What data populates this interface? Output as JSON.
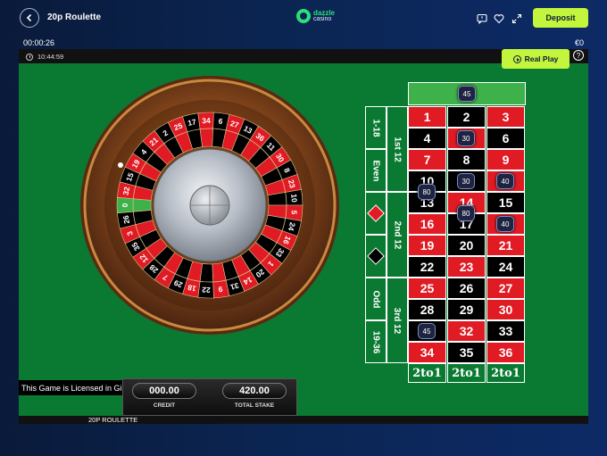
{
  "header": {
    "title": "20p Roulette",
    "logo_line1": "dazzle",
    "logo_line2": "casino",
    "deposit_label": "Deposit"
  },
  "session": {
    "timer": "00:00:26",
    "balance": "€0"
  },
  "game": {
    "clock": "10:44:59",
    "real_play_label": "Real Play",
    "help_label": "?",
    "license_text": "This Game is Licensed in Gibraltar",
    "credit_value": "000.00",
    "credit_label": "CREDIT",
    "stake_value": "420.00",
    "stake_label": "TOTAL STAKE",
    "game_name": "20P ROULETTE"
  },
  "wheel": {
    "numbers": [
      "0",
      "32",
      "15",
      "19",
      "4",
      "21",
      "2",
      "25",
      "17",
      "34",
      "6",
      "27",
      "13",
      "36",
      "11",
      "30",
      "8",
      "23",
      "10",
      "5",
      "24",
      "16",
      "33",
      "1",
      "20",
      "14",
      "31",
      "9",
      "22",
      "18",
      "29",
      "7",
      "28",
      "12",
      "35",
      "3",
      "26"
    ]
  },
  "table": {
    "rows": [
      [
        {
          "n": "1",
          "c": "red"
        },
        {
          "n": "2",
          "c": "black"
        },
        {
          "n": "3",
          "c": "red"
        }
      ],
      [
        {
          "n": "4",
          "c": "black"
        },
        {
          "n": "5",
          "c": "red"
        },
        {
          "n": "6",
          "c": "black"
        }
      ],
      [
        {
          "n": "7",
          "c": "red"
        },
        {
          "n": "8",
          "c": "black"
        },
        {
          "n": "9",
          "c": "red"
        }
      ],
      [
        {
          "n": "10",
          "c": "black"
        },
        {
          "n": "11",
          "c": "black"
        },
        {
          "n": "12",
          "c": "red"
        }
      ],
      [
        {
          "n": "13",
          "c": "black"
        },
        {
          "n": "14",
          "c": "red"
        },
        {
          "n": "15",
          "c": "black"
        }
      ],
      [
        {
          "n": "16",
          "c": "red"
        },
        {
          "n": "17",
          "c": "black"
        },
        {
          "n": "18",
          "c": "red"
        }
      ],
      [
        {
          "n": "19",
          "c": "red"
        },
        {
          "n": "20",
          "c": "black"
        },
        {
          "n": "21",
          "c": "red"
        }
      ],
      [
        {
          "n": "22",
          "c": "black"
        },
        {
          "n": "23",
          "c": "red"
        },
        {
          "n": "24",
          "c": "black"
        }
      ],
      [
        {
          "n": "25",
          "c": "red"
        },
        {
          "n": "26",
          "c": "black"
        },
        {
          "n": "27",
          "c": "red"
        }
      ],
      [
        {
          "n": "28",
          "c": "black"
        },
        {
          "n": "29",
          "c": "black"
        },
        {
          "n": "30",
          "c": "red"
        }
      ],
      [
        {
          "n": "31",
          "c": "black"
        },
        {
          "n": "32",
          "c": "red"
        },
        {
          "n": "33",
          "c": "black"
        }
      ],
      [
        {
          "n": "34",
          "c": "red"
        },
        {
          "n": "35",
          "c": "black"
        },
        {
          "n": "36",
          "c": "red"
        }
      ]
    ],
    "column_bets": [
      "2to1",
      "2to1",
      "2to1"
    ],
    "dozens": [
      "1st 12",
      "2nd 12",
      "3rd 12"
    ],
    "outside": [
      "1-18",
      "Even",
      "Odd",
      "19-36"
    ],
    "colors": {
      "red": "#e01b24",
      "black": "#000000",
      "felt": "#0a7a32",
      "zero": "#3fb14a"
    }
  },
  "chips": [
    {
      "value": "45",
      "at": "zero"
    },
    {
      "value": "30",
      "at": "5"
    },
    {
      "value": "80",
      "at": "10-13"
    },
    {
      "value": "30",
      "at": "11"
    },
    {
      "value": "40",
      "at": "12"
    },
    {
      "value": "80",
      "at": "14-17"
    },
    {
      "value": "40",
      "at": "18"
    },
    {
      "value": "45",
      "at": "31"
    }
  ]
}
